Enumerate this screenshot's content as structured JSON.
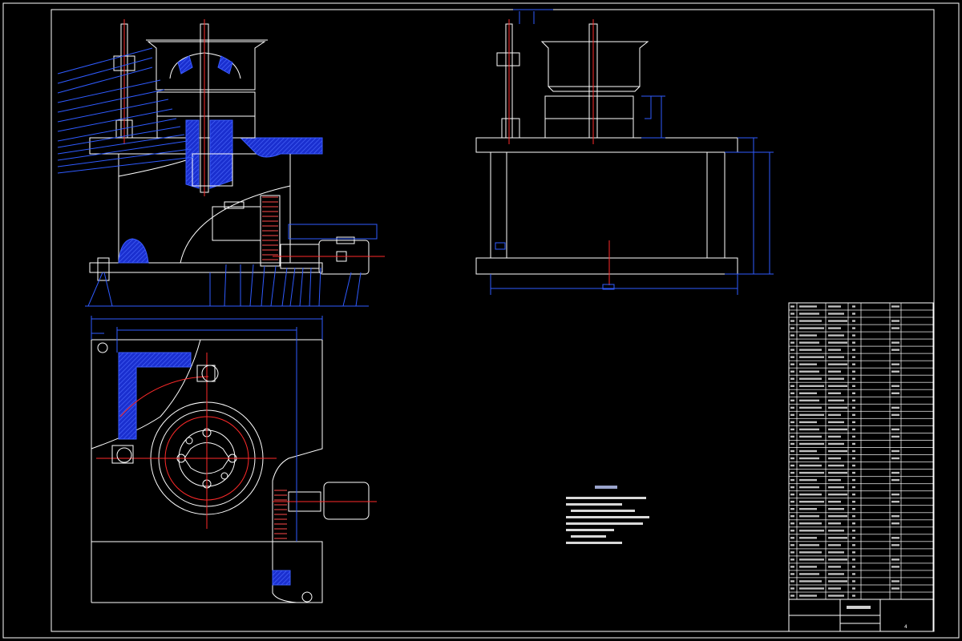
{
  "colors": {
    "background": "#000000",
    "outline": "#ffffff",
    "dimension": "#2f5bff",
    "centerline": "#ff2a2a",
    "hatch": "#3a5cff"
  },
  "views": {
    "front": "front-elevation",
    "side": "side-elevation",
    "plan": "plan-view"
  },
  "title_block": {
    "sheet_number": "4"
  }
}
